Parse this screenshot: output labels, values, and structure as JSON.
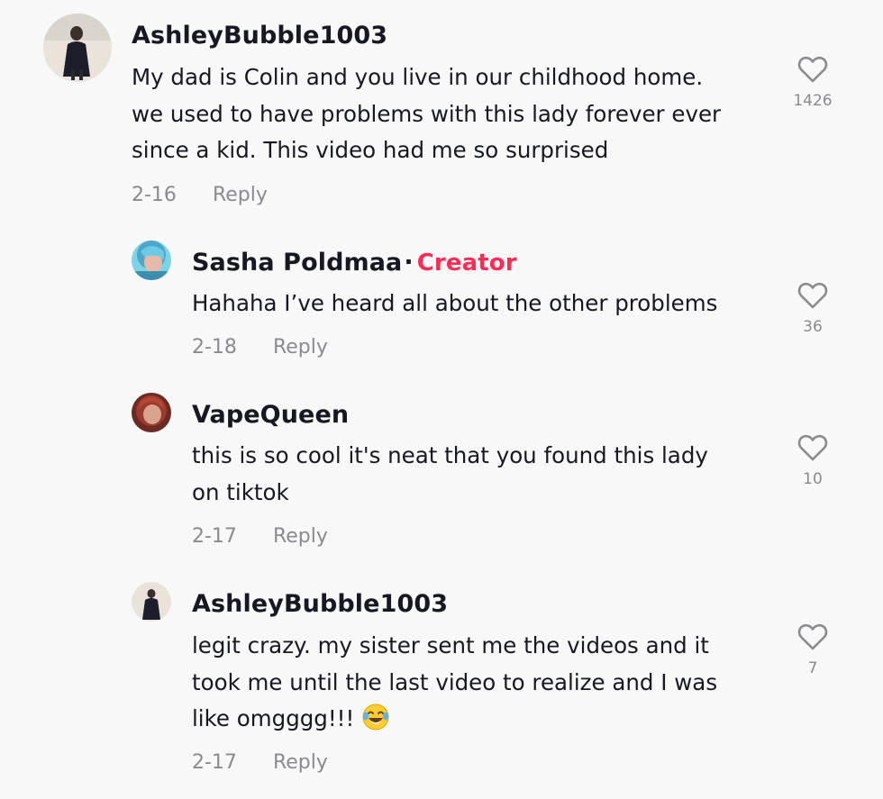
{
  "comments": [
    {
      "username": "AshleyBubble1003",
      "text": "My dad is Colin and you live in our childhood home.\nwe used to have problems with this lady forever ever\nsince a kid. This video had me so surprised",
      "date": "2-16",
      "reply_label": "Reply",
      "likes": "1426"
    },
    {
      "username": "Sasha Poldmaa",
      "separator": "·",
      "badge": "Creator",
      "text": "Hahaha I’ve heard all about the other problems",
      "date": "2-18",
      "reply_label": "Reply",
      "likes": "36"
    },
    {
      "username": "VapeQueen",
      "text": "this is so cool it's neat that you found this lady\non tiktok",
      "date": "2-17",
      "reply_label": "Reply",
      "likes": "10"
    },
    {
      "username": "AshleyBubble1003",
      "text": "legit crazy. my sister sent me the videos and it\ntook me until the last video to realize and I was\nlike omgggg!!!",
      "emoji": "face-with-tears-of-joy-emoji",
      "date": "2-17",
      "reply_label": "Reply",
      "likes": "7"
    }
  ],
  "colors": {
    "creator_badge": "#fe2c55",
    "muted_text": "#8a8b91",
    "primary_text": "#161823",
    "background": "#f8f8f8"
  },
  "icons": {
    "like": "heart-outline-icon",
    "avatar": "user-avatar-photo"
  }
}
